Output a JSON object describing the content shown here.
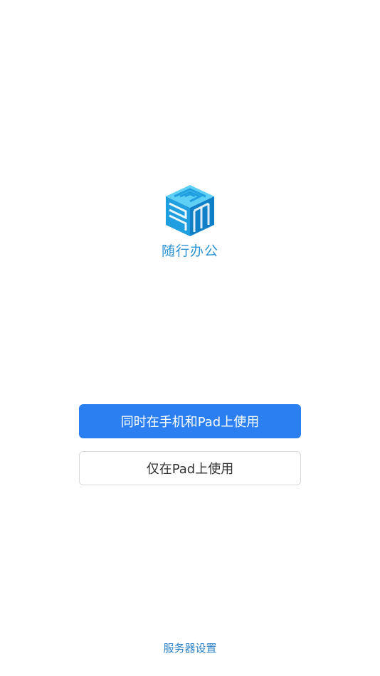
{
  "app": {
    "name": "随行办公",
    "logo_icon": "cube-logo-icon",
    "brand_color": "#2a93d5"
  },
  "actions": {
    "primary_label": "同时在手机和Pad上使用",
    "primary_color": "#2b7ff0",
    "secondary_label": "仅在Pad上使用"
  },
  "footer": {
    "server_settings_label": "服务器设置"
  }
}
